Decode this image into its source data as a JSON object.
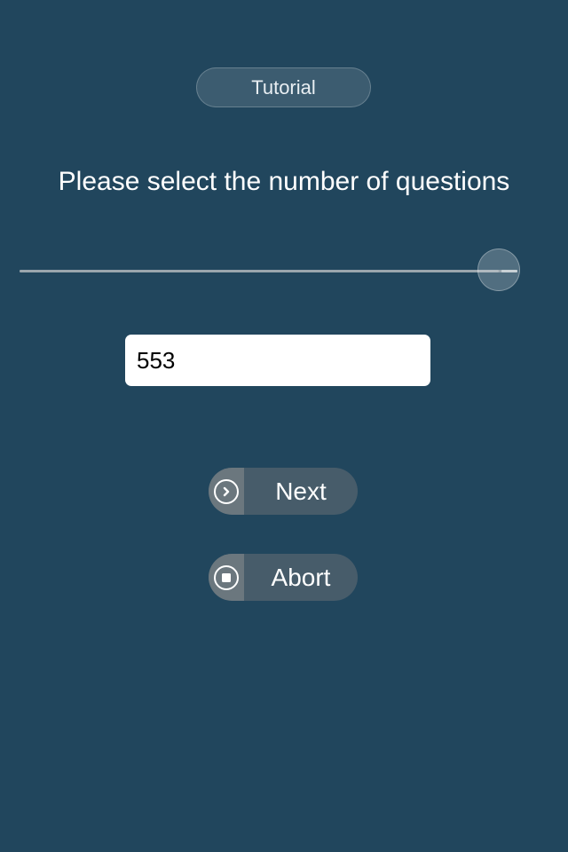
{
  "tutorial": {
    "label": "Tutorial"
  },
  "prompt": {
    "text": "Please select the number of questions"
  },
  "slider": {
    "value_fraction": 0.96,
    "thumb_icon": "dash-mark"
  },
  "count_field": {
    "value": "553"
  },
  "actions": {
    "next_label": "Next",
    "next_icon": "chevron-right-circle-icon",
    "abort_label": "Abort",
    "abort_icon": "stop-circle-icon"
  },
  "colors": {
    "background": "#21465d",
    "button_bg": "#475c6a",
    "button_icon_bg": "#6b777e",
    "text": "#ffffff"
  }
}
